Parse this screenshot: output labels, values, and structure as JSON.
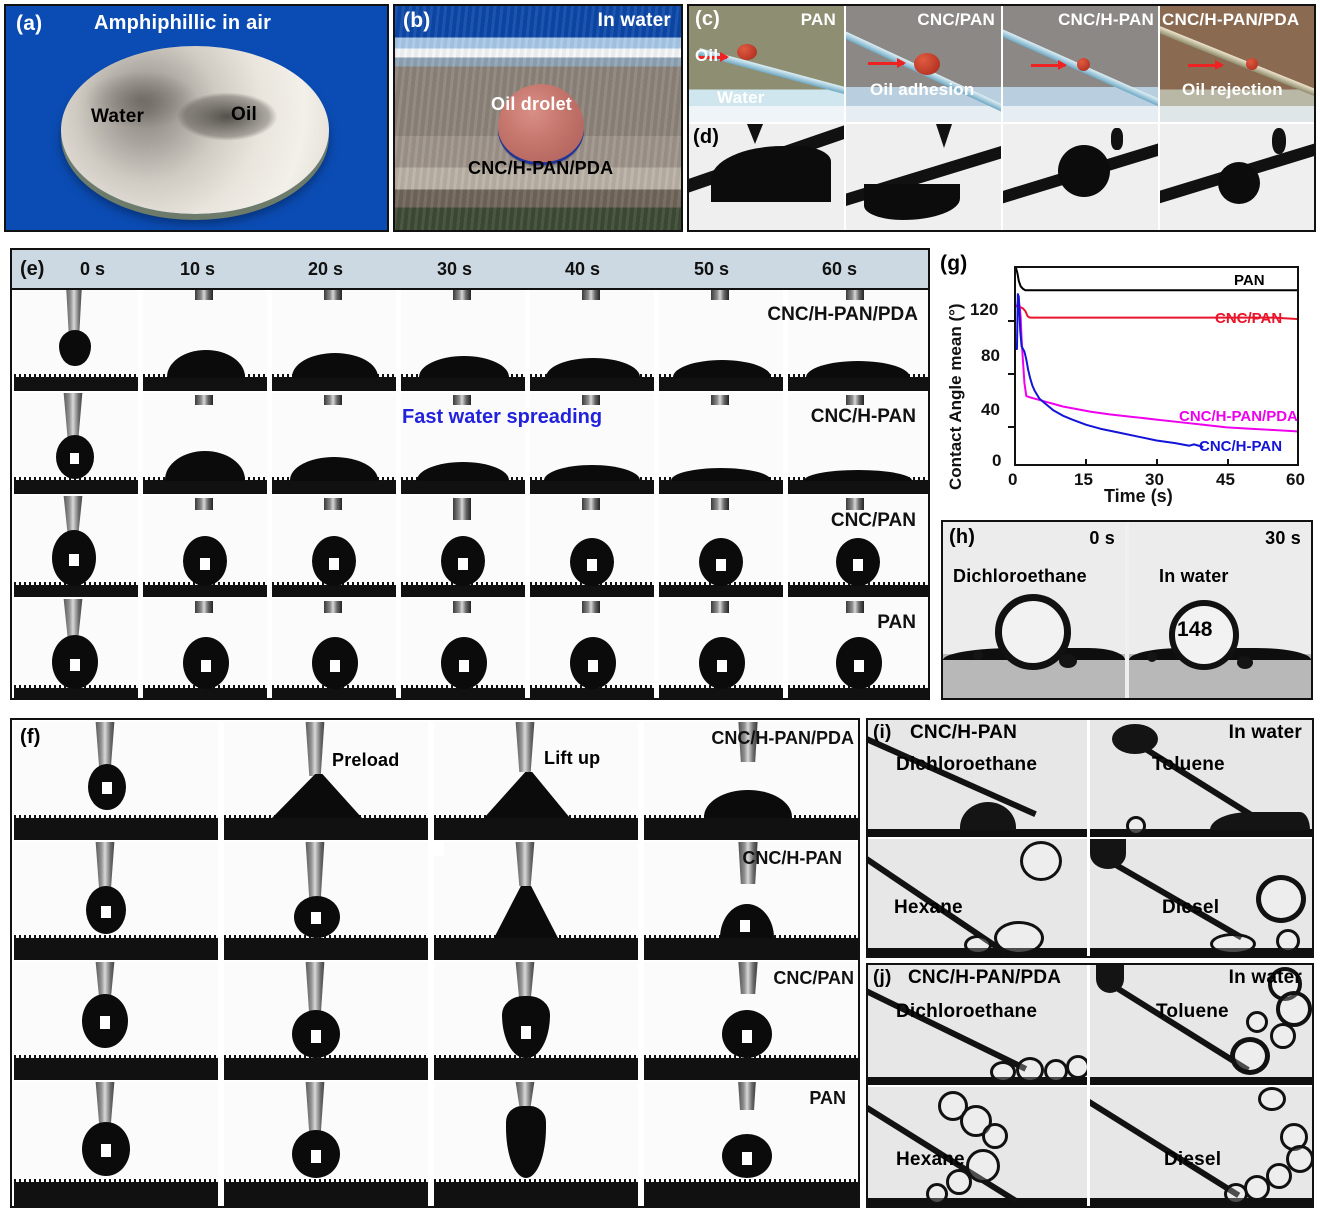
{
  "figure": {
    "panels": {
      "a": {
        "tag": "(a)",
        "title": "Amphiphillic in air",
        "labels": [
          "Water",
          "Oil"
        ],
        "bg_color": "#0b4cb4"
      },
      "b": {
        "tag": "(b)",
        "title": "In water",
        "labels": [
          "Oil drolet",
          "CNC/H-PAN/PDA"
        ]
      },
      "c": {
        "tag": "(c)",
        "titles": [
          "PAN",
          "CNC/PAN",
          "CNC/H-PAN",
          "CNC/H-PAN/PDA"
        ],
        "annotations": [
          "Oil",
          "Water",
          "Oil adhesion",
          "Oil rejection"
        ],
        "arrow_color": "#ee2222"
      },
      "d": {
        "tag": "(d)"
      },
      "e": {
        "tag": "(e)",
        "times": [
          "0 s",
          "10 s",
          "20 s",
          "30 s",
          "40 s",
          "50 s",
          "60 s"
        ],
        "rows": [
          "CNC/H-PAN/PDA",
          "CNC/H-PAN",
          "CNC/PAN",
          "PAN"
        ],
        "annotation": "Fast water spreading",
        "annotation_color": "#2222dd",
        "header_bg": "#ccd9e2"
      },
      "f": {
        "tag": "(f)",
        "steps": [
          "Preload",
          "Lift up"
        ],
        "rows": [
          "CNC/H-PAN/PDA",
          "CNC/H-PAN",
          "CNC/PAN",
          "PAN"
        ]
      },
      "g": {
        "tag": "(g)"
      },
      "h": {
        "tag": "(h)",
        "times": [
          "0 s",
          "30 s"
        ],
        "labels": [
          "Dichloroethane",
          "In water"
        ],
        "angle_value": "148"
      },
      "i": {
        "tag": "(i)",
        "title": "CNC/H-PAN",
        "corner": "In water",
        "oils": [
          "Dichloroethane",
          "Toluene",
          "Hexane",
          "Diesel"
        ]
      },
      "j": {
        "tag": "(j)",
        "title": "CNC/H-PAN/PDA",
        "corner": "In water",
        "oils": [
          "Dichloroethane",
          "Toluene",
          "Hexane",
          "Diesel"
        ]
      }
    }
  },
  "chart_data": {
    "type": "line",
    "title": "",
    "xlabel": "Time (s)",
    "ylabel": "Contact Angle mean (°)",
    "xlim": [
      0,
      60
    ],
    "ylim": [
      0,
      150
    ],
    "xticks": [
      0,
      15,
      30,
      45,
      60
    ],
    "yticks": [
      0,
      40,
      80,
      120
    ],
    "grid": false,
    "legend_position": "inline-right",
    "series": [
      {
        "name": "PAN",
        "color": "#000000",
        "label_x": 52,
        "label_y": 145,
        "x": [
          0,
          0.3,
          0.6,
          1,
          1.5,
          2,
          3,
          5,
          8,
          12,
          16,
          20,
          25,
          30,
          35,
          40,
          45,
          50,
          55,
          60
        ],
        "y": [
          150,
          146,
          140,
          136,
          134,
          133,
          133,
          133,
          133,
          133,
          133,
          133,
          133,
          133,
          133,
          133,
          133,
          133,
          133,
          133
        ]
      },
      {
        "name": "CNC/PAN",
        "color": "#e8152b",
        "label_x": 50,
        "label_y": 122,
        "x": [
          0,
          0.3,
          0.6,
          1,
          1.5,
          2,
          2.5,
          3,
          5,
          8,
          12,
          16,
          20,
          25,
          30,
          35,
          40,
          45,
          50,
          55,
          60
        ],
        "y": [
          121,
          121,
          120,
          120,
          119,
          117,
          113,
          112,
          112,
          112,
          112,
          112,
          112,
          112,
          112,
          112,
          112,
          112,
          112,
          112,
          111
        ]
      },
      {
        "name": "CNC/H-PAN/PDA",
        "color": "#ee00ee",
        "label_x": 46,
        "label_y": 36,
        "x": [
          0,
          0.3,
          0.5,
          0.8,
          1.0,
          1.2,
          1.5,
          1.8,
          2.2,
          3,
          4,
          5,
          6,
          8,
          10,
          13,
          16,
          20,
          25,
          30,
          35,
          40,
          45,
          50,
          55,
          60
        ],
        "y": [
          120,
          122,
          127,
          120,
          112,
          95,
          78,
          62,
          52,
          51,
          50,
          49,
          48,
          46,
          44,
          42,
          40,
          38,
          36,
          34,
          32,
          30,
          28,
          27,
          26,
          25
        ]
      },
      {
        "name": "CNC/H-PAN",
        "color": "#1414d8",
        "label_x": 42,
        "label_y": 13,
        "x": [
          0,
          0.2,
          0.4,
          0.6,
          0.9,
          1.2,
          1.5,
          1.8,
          2.2,
          2.6,
          3,
          3.5,
          4,
          5,
          6,
          7,
          8,
          10,
          12,
          15,
          18,
          22,
          26,
          30,
          34,
          37,
          38,
          40
        ],
        "y": [
          88,
          88,
          130,
          128,
          102,
          90,
          88,
          86,
          80,
          72,
          66,
          60,
          56,
          50,
          47,
          44,
          41,
          37,
          34,
          30,
          27,
          24,
          21,
          18,
          16,
          14,
          15,
          13
        ]
      }
    ]
  }
}
